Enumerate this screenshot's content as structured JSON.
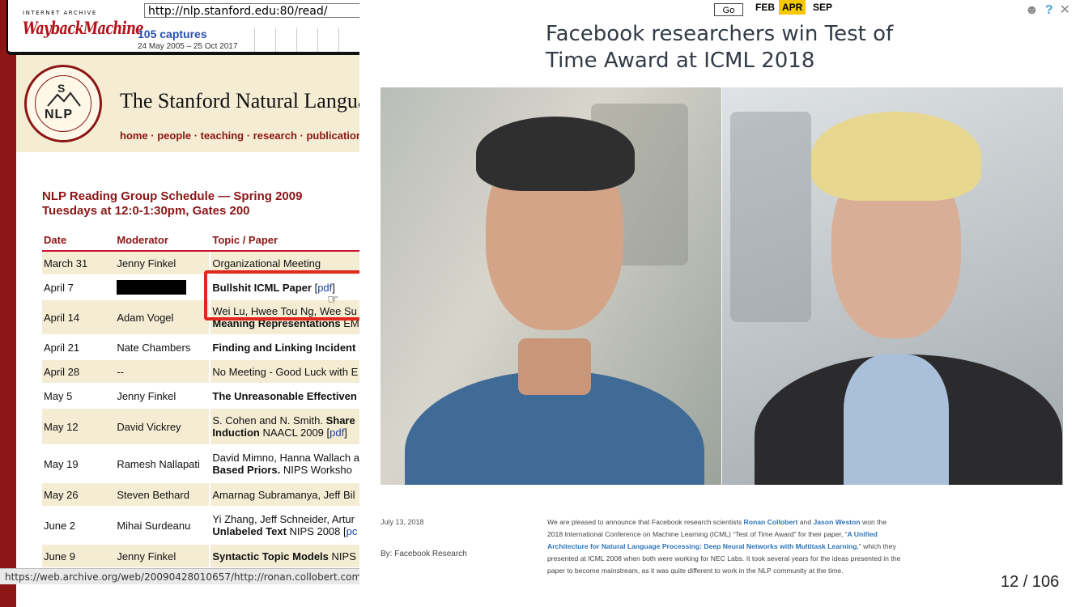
{
  "wayback": {
    "small_label": "INTERNET ARCHIVE",
    "logo": "WaybackMachine",
    "url": "http://nlp.stanford.edu:80/read/",
    "captures": "105 captures",
    "range": "24 May 2005 – 25 Oct 2017",
    "go": "Go",
    "months": {
      "prev": "FEB",
      "current": "APR",
      "next": "SEP"
    }
  },
  "stanford": {
    "seal_letters": "S",
    "seal_nlp": "NLP",
    "title": "The Stanford Natural Langua",
    "nav": "home · people · teaching · research · publication",
    "schedule_title_1": "NLP Reading Group Schedule — Spring 2009",
    "schedule_title_2": "Tuesdays at 12:0-1:30pm, Gates 200",
    "headers": {
      "date": "Date",
      "moderator": "Moderator",
      "topic": "Topic / Paper"
    },
    "rows": [
      {
        "date": "March 31",
        "moderator": "Jenny Finkel",
        "topic": "Organizational Meeting"
      },
      {
        "date": "April 7",
        "moderator": "",
        "topic_bold": "Bullshit ICML Paper",
        "topic_link": "pdf"
      },
      {
        "date": "April 14",
        "moderator": "Adam Vogel",
        "topic": "Wei Lu, Hwee Tou Ng, Wee Su",
        "topic_2": "Meaning Representations",
        "topic_2b": " EM"
      },
      {
        "date": "April 21",
        "moderator": "Nate Chambers",
        "topic_bold": "Finding and Linking Incident"
      },
      {
        "date": "April 28",
        "moderator": "--",
        "topic": "No Meeting - Good Luck with E"
      },
      {
        "date": "May 5",
        "moderator": "Jenny Finkel",
        "topic_bold": "The Unreasonable Effectiven"
      },
      {
        "date": "May 12",
        "moderator": "David Vickrey",
        "topic": "S. Cohen and N. Smith.",
        "topic_b": " Share",
        "topic_2b": "Induction",
        "topic_2": " NAACL 2009 [",
        "topic_link": "pdf",
        "topic_end": "]"
      },
      {
        "date": "May 19",
        "moderator": "Ramesh Nallapati",
        "topic": "David Mimno, Hanna Wallach a",
        "topic_2b": "Based Priors.",
        "topic_2": " NIPS Worksho"
      },
      {
        "date": "May 26",
        "moderator": "Steven Bethard",
        "topic": "Amarnag Subramanya, Jeff Bil"
      },
      {
        "date": "June 2",
        "moderator": "Mihai Surdeanu",
        "topic": "Yi Zhang, Jeff Schneider, Artur",
        "topic_2b": "Unlabeled Text",
        "topic_2": " NIPS 2008 [",
        "topic_link": "pc"
      },
      {
        "date": "June 9",
        "moderator": "Jenny Finkel",
        "topic_bold": "Syntactic Topic Models",
        "topic": " NIPS"
      }
    ],
    "status_url": "https://web.archive.org/web/20090428010657/http://ronan.collobert.com"
  },
  "article": {
    "title": "Facebook researchers win Test of Time Award at ICML 2018",
    "date": "July 13, 2018",
    "by": "By: Facebook Research",
    "body_1": "We are pleased to announce that Facebook research scientists ",
    "name_1": "Ronan Collobert",
    "body_2": " and ",
    "name_2": "Jason Weston",
    "body_3": " won the 2018 International Conference on Machine Learning (ICML) “Test of Time Award” for their paper, “",
    "paper": "A Unified Architecture for Natural Language Processing: Deep Neural Networks with Multitask Learning",
    "body_4": ",” which they presented at ICML 2008 when both were working for NEC Labs. It took several years for the ideas presented in the paper to become mainstream, as it was quite different to work in the NLP community at the time."
  },
  "slide_counter": "12 / 106",
  "colors": {
    "stanford_red": "#8c1515",
    "accent_red": "#e0281e",
    "apr_highlight": "#f5c800",
    "link_blue": "#2d74b9"
  },
  "icons": [
    "user-icon",
    "help-icon",
    "close-icon",
    "cursor-hand-icon"
  ]
}
